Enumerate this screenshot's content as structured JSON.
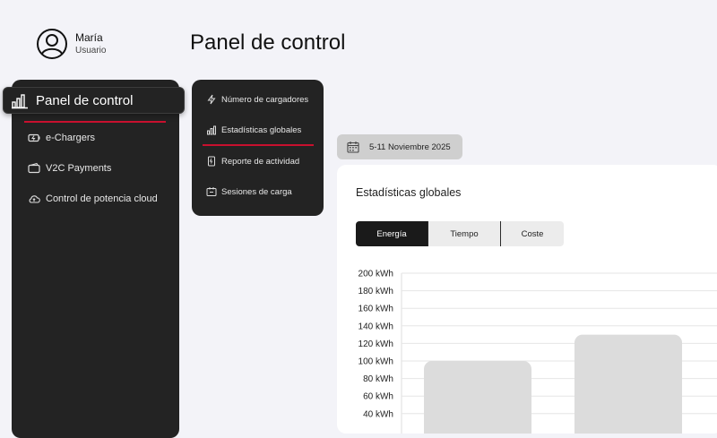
{
  "user": {
    "name": "María",
    "role": "Usuario",
    "avatar_icon": "user-circle-icon"
  },
  "page_title": "Panel de control",
  "sidebar": {
    "active": {
      "label": "Panel de control",
      "icon": "bar-chart-icon"
    },
    "items": [
      {
        "label": "e-Chargers",
        "icon": "battery-icon"
      },
      {
        "label": "V2C Payments",
        "icon": "wallet-icon"
      },
      {
        "label": "Control de potencia cloud",
        "icon": "cloud-icon"
      }
    ],
    "accent": "#c8102e"
  },
  "submenu": {
    "items": [
      {
        "label": "Número de cargadores",
        "icon": "lightning-icon"
      },
      {
        "label": "Estadísticas globales",
        "icon": "bar-chart-icon",
        "active": true
      },
      {
        "label": "Reporte de actividad",
        "icon": "document-icon"
      },
      {
        "label": "Sesiones de carga",
        "icon": "charger-icon"
      }
    ]
  },
  "date_range": {
    "label": "5-11 Noviembre 2025",
    "icon": "calendar-icon"
  },
  "stats": {
    "title": "Estadísticas globales",
    "tabs": [
      {
        "label": "Energía",
        "active": true
      },
      {
        "label": "Tiempo",
        "active": false
      },
      {
        "label": "Coste",
        "active": false
      }
    ]
  },
  "chart_data": {
    "type": "bar",
    "values": [
      100,
      130
    ],
    "ylim": [
      0,
      200
    ],
    "yticks": [
      "40 kWh",
      "60 kWh",
      "80 kWh",
      "100 kWh",
      "120 kWh",
      "140 kWh",
      "160 kWh",
      "180 kWh",
      "200 kWh"
    ],
    "ytick_values": [
      40,
      60,
      80,
      100,
      120,
      140,
      160,
      180,
      200
    ],
    "grid": true,
    "bar_color": "#dcdcdc"
  }
}
